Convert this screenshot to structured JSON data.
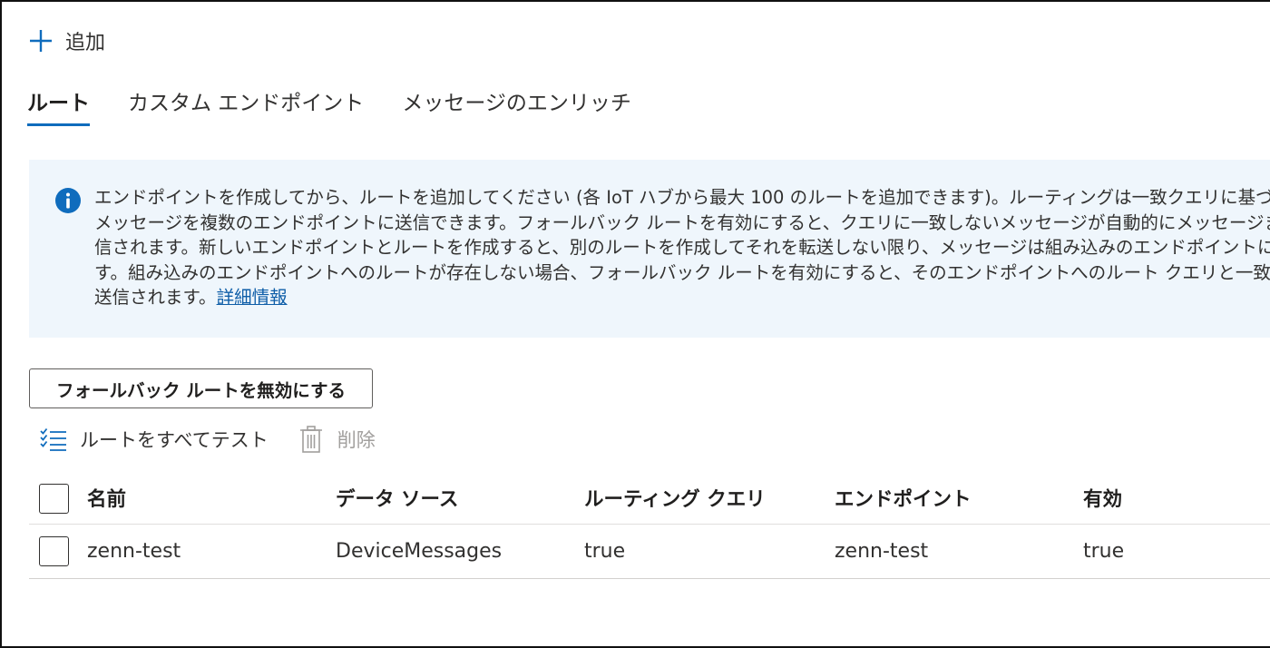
{
  "commands": {
    "add_label": "追加"
  },
  "tabs": [
    {
      "label": "ルート",
      "active": true
    },
    {
      "label": "カスタム エンドポイント",
      "active": false
    },
    {
      "label": "メッセージのエンリッチ",
      "active": false
    }
  ],
  "banner": {
    "lines": [
      "エンドポイントを作成してから、ルートを追加してください (各 IoT ハブから最大 100 のルートを追加できます)。ルーティングは一致クエリに基づいているため",
      "メッセージを複数のエンドポイントに送信できます。フォールバック ルートを有効にすると、クエリに一致しないメッセージが自動的にメッセージまたはイベントに送",
      "信されます。新しいエンドポイントとルートを作成すると、別のルートを作成してそれを転送しない限り、メッセージは組み込みのエンドポイントに流れなくなりま",
      "す。組み込みのエンドポイントへのルートが存在しない場合、フォールバック ルートを有効にすると、そのエンドポイントへのルート クエリと一致しないメッセージが",
      "送信されます。"
    ],
    "link": "詳細情報"
  },
  "fallback_button": "フォールバック ルートを無効にする",
  "toolbar": {
    "test_all": "ルートをすべてテスト",
    "delete": "削除"
  },
  "table": {
    "columns": [
      "名前",
      "データ ソース",
      "ルーティング クエリ",
      "エンドポイント",
      "有効"
    ],
    "rows": [
      {
        "name": "zenn-test",
        "source": "DeviceMessages",
        "query": "true",
        "endpoint": "zenn-test",
        "enabled": "true"
      }
    ]
  },
  "colors": {
    "accent": "#0f6cbd",
    "banner_bg": "#eff6fc"
  }
}
